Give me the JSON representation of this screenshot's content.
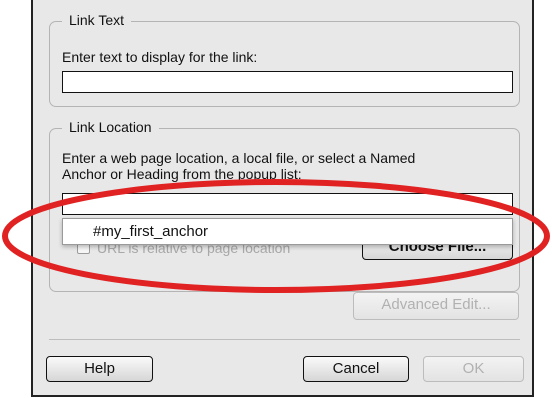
{
  "link_text": {
    "legend": "Link Text",
    "prompt": "Enter text to display for the link:",
    "input_value": ""
  },
  "link_location": {
    "legend": "Link Location",
    "prompt_line1": "Enter a web page location, a local file, or select a Named",
    "prompt_line2": "Anchor or Heading from the popup list:",
    "input_value": "",
    "popup_items": [
      "#my_first_anchor"
    ],
    "checkbox_label": "URL is relative to page location",
    "choose_file_label": "Choose File..."
  },
  "advanced_edit_label": "Advanced Edit...",
  "buttons": {
    "help": "Help",
    "cancel": "Cancel",
    "ok": "OK"
  },
  "colors": {
    "annotation_ellipse": "#e02222"
  }
}
